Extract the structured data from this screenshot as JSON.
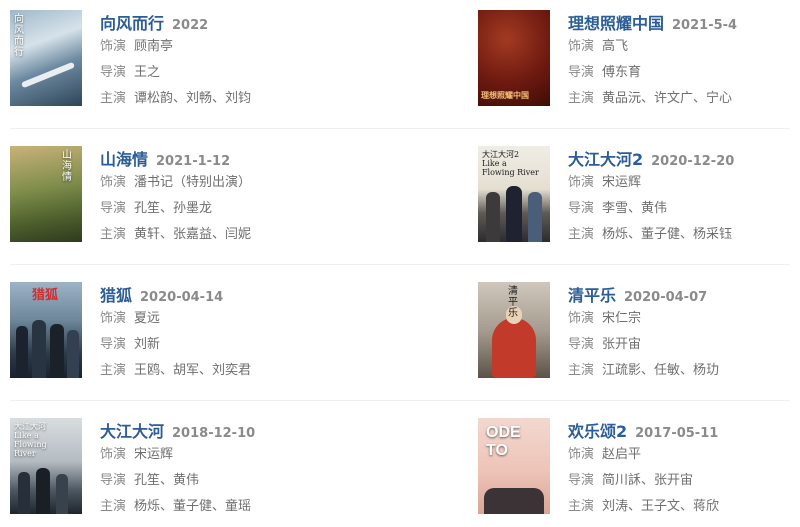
{
  "colors": {
    "title": "#2c5d96",
    "label": "#8a8a8a",
    "value": "#6f6f6f",
    "divider": "#efefef"
  },
  "items": [
    {
      "title": "向风而行",
      "date": "2022",
      "row1_label": "饰演",
      "row1_value": "顾南亭",
      "row2_label": "导演",
      "row2_value": "王之",
      "row3_label": "主演",
      "row3_value": "谭松韵、刘畅、刘钧",
      "poster_text": "向\n风\n而\n行",
      "poster_icon": "airplane-poster"
    },
    {
      "title": "理想照耀中国",
      "date": "2021-5-4",
      "row1_label": "饰演",
      "row1_value": "高飞",
      "row2_label": "导演",
      "row2_value": "傅东育",
      "row3_label": "主演",
      "row3_value": "黄品沅、许文广、宁心",
      "poster_text": "理想照耀中国",
      "poster_icon": "red-crowd-poster"
    },
    {
      "title": "山海情",
      "date": "2021-1-12",
      "row1_label": "饰演",
      "row1_value": "潘书记（特别出演）",
      "row2_label": "导演",
      "row2_value": "孔笙、孙墨龙",
      "row3_label": "主演",
      "row3_value": "黄轩、张嘉益、闫妮",
      "poster_text": "山\n海\n情",
      "poster_icon": "landscape-poster"
    },
    {
      "title": "大江大河2",
      "date": "2020-12-20",
      "row1_label": "饰演",
      "row1_value": "宋运辉",
      "row2_label": "导演",
      "row2_value": "李雪、黄伟",
      "row3_label": "主演",
      "row3_value": "杨烁、董子健、杨采钰",
      "poster_text": "大江大河2\nLike a\nFlowing River",
      "poster_icon": "people-poster"
    },
    {
      "title": "猎狐",
      "date": "2020-04-14",
      "row1_label": "饰演",
      "row1_value": "夏远",
      "row2_label": "导演",
      "row2_value": "刘新",
      "row3_label": "主演",
      "row3_value": "王鸥、胡军、刘奕君",
      "poster_text": "猎狐",
      "poster_icon": "police-poster"
    },
    {
      "title": "清平乐",
      "date": "2020-04-07",
      "row1_label": "饰演",
      "row1_value": "宋仁宗",
      "row2_label": "导演",
      "row2_value": "张开宙",
      "row3_label": "主演",
      "row3_value": "江疏影、任敏、杨玏",
      "poster_text": "清\n平\n乐",
      "poster_icon": "emperor-poster"
    },
    {
      "title": "大江大河",
      "date": "2018-12-10",
      "row1_label": "饰演",
      "row1_value": "宋运辉",
      "row2_label": "导演",
      "row2_value": "孔笙、黄伟",
      "row3_label": "主演",
      "row3_value": "杨烁、董子健、童瑶",
      "poster_text": "大江大河\nLike a\nFlowing\nRiver",
      "poster_icon": "people-poster"
    },
    {
      "title": "欢乐颂2",
      "date": "2017-05-11",
      "row1_label": "饰演",
      "row1_value": "赵启平",
      "row2_label": "导演",
      "row2_value": "简川訸、张开宙",
      "row3_label": "主演",
      "row3_value": "刘涛、王子文、蒋欣",
      "poster_text": "ODE\nTO",
      "poster_icon": "ode-poster"
    }
  ]
}
